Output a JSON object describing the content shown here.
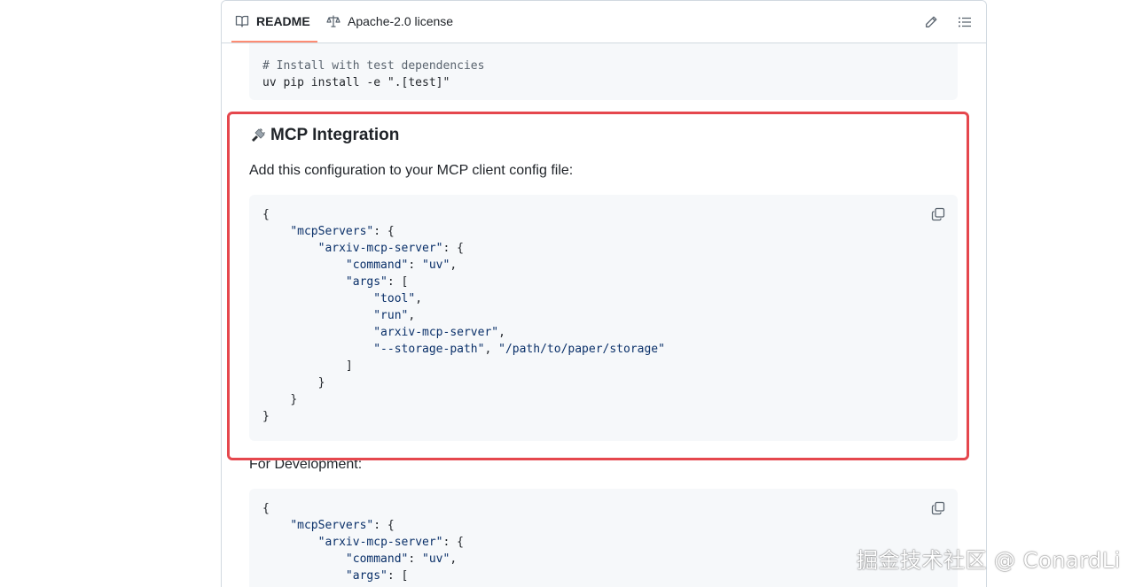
{
  "tabs": {
    "readme_label": "README",
    "license_label": "Apache-2.0 license"
  },
  "top_code": {
    "comment": "# Install with test dependencies",
    "command": "uv pip install -e \".[test]\""
  },
  "mcp_section": {
    "heading": "MCP Integration",
    "description": "Add this configuration to your MCP client config file:",
    "code": {
      "l1": "{",
      "k_mcp": "\"mcpServers\"",
      "k_server": "\"arxiv-mcp-server\"",
      "k_command": "\"command\"",
      "v_uv": "\"uv\"",
      "k_args": "\"args\"",
      "a_tool": "\"tool\"",
      "a_run": "\"run\"",
      "a_server": "\"arxiv-mcp-server\"",
      "a_flag": "\"--storage-path\"",
      "a_path": "\"/path/to/paper/storage\"",
      "close_bracket": "]",
      "close_brace": "}"
    }
  },
  "dev_section": {
    "label": "For Development:"
  },
  "watermark": "掘金技术社区 @ ConardLi",
  "colors": {
    "highlight": "#e5474d",
    "tab_underline": "#fd8c73",
    "code_string": "#0a3069"
  }
}
